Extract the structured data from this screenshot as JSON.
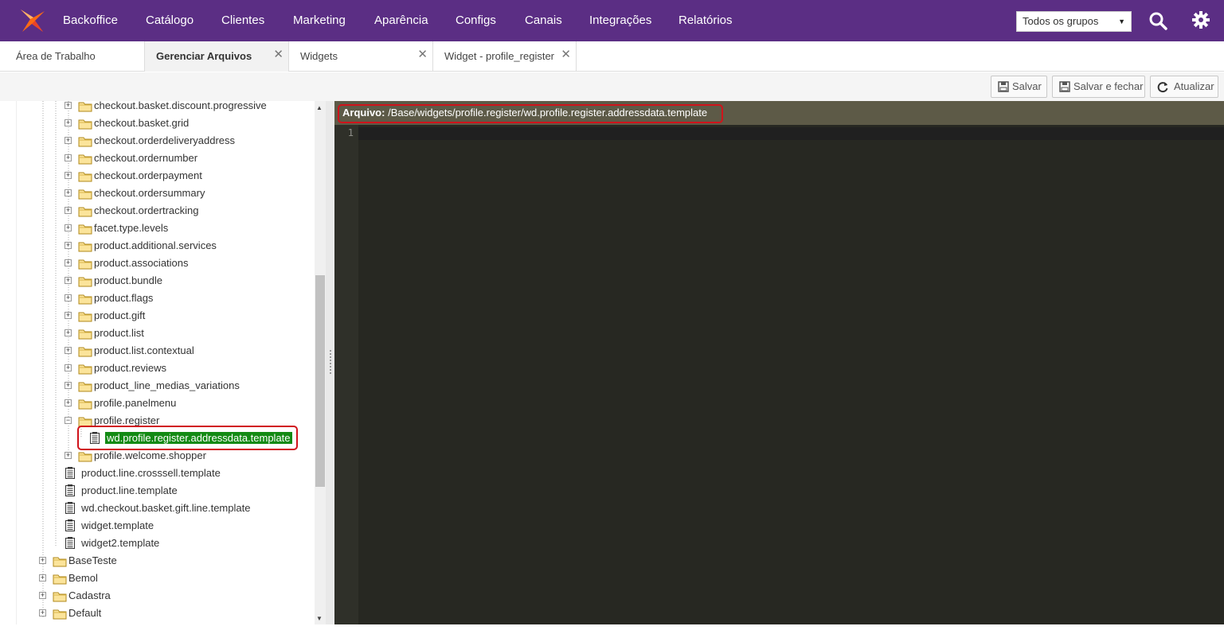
{
  "nav": {
    "items": [
      "Backoffice",
      "Catálogo",
      "Clientes",
      "Marketing",
      "Aparência",
      "Configs",
      "Canais",
      "Integrações",
      "Relatórios"
    ],
    "group_select": "Todos os grupos",
    "brand_color": "#5b2e84"
  },
  "tabs": [
    {
      "label": "Área de Trabalho"
    },
    {
      "label": "Gerenciar Arquivos"
    },
    {
      "label": "Widgets"
    },
    {
      "label": "Widget - profile_register"
    }
  ],
  "actions": {
    "save": "Salvar",
    "save_close": "Salvar e fechar",
    "refresh": "Atualizar"
  },
  "tree": {
    "folders_top": [
      "checkout.basket.discount.progressive",
      "checkout.basket.grid",
      "checkout.orderdeliveryaddress",
      "checkout.ordernumber",
      "checkout.orderpayment",
      "checkout.ordersummary",
      "checkout.ordertracking",
      "facet.type.levels",
      "product.additional.services",
      "product.associations",
      "product.bundle",
      "product.flags",
      "product.gift",
      "product.list",
      "product.list.contextual",
      "product.reviews",
      "product_line_medias_variations",
      "profile.panelmenu",
      "profile.register"
    ],
    "selected_file": "wd.profile.register.addressdata.template",
    "folder_after": "profile.welcome.shopper",
    "files": [
      "product.line.crosssell.template",
      "product.line.template",
      "wd.checkout.basket.gift.line.template",
      "widget.template",
      "widget2.template"
    ],
    "root_folders": [
      "BaseTeste",
      "Bemol",
      "Cadastra",
      "Default"
    ],
    "selected_color": "#138a14"
  },
  "editor": {
    "label": "Arquivo:",
    "path": "/Base/widgets/profile.register/wd.profile.register.addressdata.template",
    "line_numbers": [
      "1"
    ],
    "background": "#272822"
  }
}
